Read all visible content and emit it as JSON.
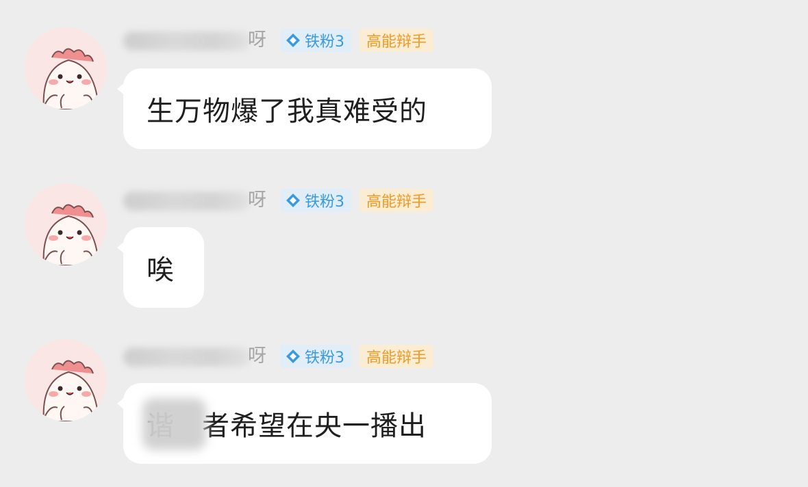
{
  "colors": {
    "background": "#ededed",
    "bubble": "#ffffff",
    "fan_badge_bg": "#e1eef8",
    "fan_badge_text": "#3a9ae0",
    "role_badge_bg": "#fbecd4",
    "role_badge_text": "#ef9a22",
    "avatar_bg": "#fbe6e6"
  },
  "messages": [
    {
      "username_visible_tail": "呀",
      "fan_badge": {
        "icon": "diamond-icon",
        "label": "铁粉3"
      },
      "role_badge": "高能辩手",
      "text": "生万物爆了我真难受的"
    },
    {
      "username_visible_tail": "呀",
      "fan_badge": {
        "icon": "diamond-icon",
        "label": "铁粉3"
      },
      "role_badge": "高能辩手",
      "text": "唉"
    },
    {
      "username_visible_tail": "呀",
      "fan_badge": {
        "icon": "diamond-icon",
        "label": "铁粉3"
      },
      "role_badge": "高能辩手",
      "text_redacted_prefix": "谐",
      "text": "者希望在央一播出"
    }
  ]
}
